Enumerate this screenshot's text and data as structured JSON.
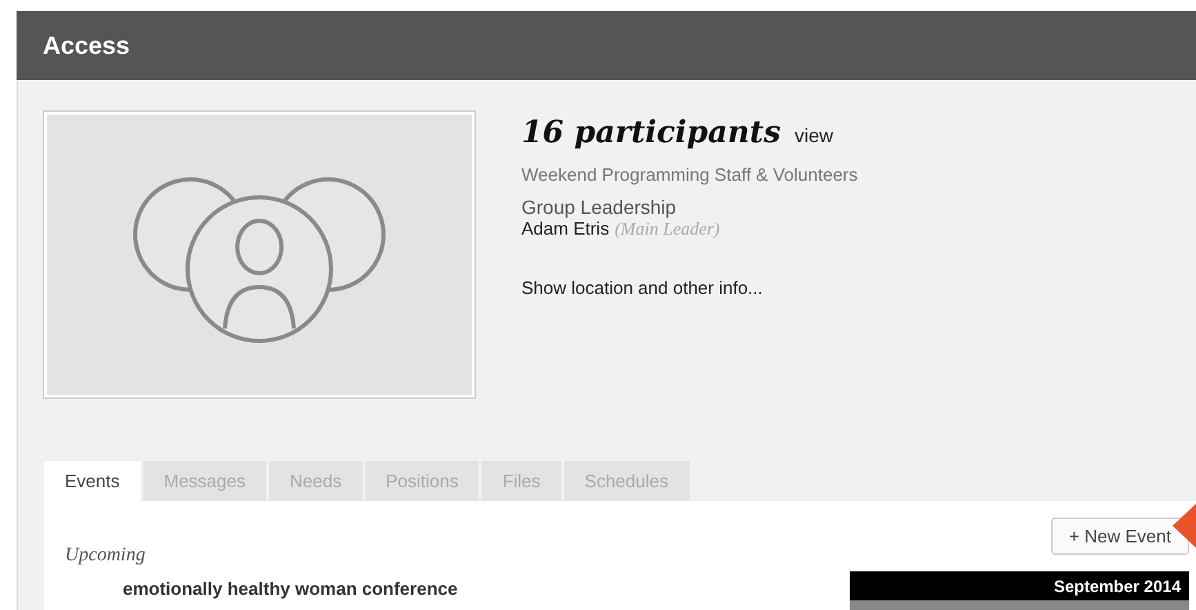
{
  "header": {
    "title": "Access"
  },
  "group": {
    "count_title": "16 participants",
    "view_link": "view",
    "name": "Weekend Programming Staff & Volunteers",
    "leadership_label": "Group Leadership",
    "leader": "Adam Etris",
    "leader_role": "(Main Leader)",
    "more_link": "Show location and other info..."
  },
  "tabs": [
    {
      "label": "Events",
      "selected": true
    },
    {
      "label": "Messages",
      "selected": false
    },
    {
      "label": "Needs",
      "selected": false
    },
    {
      "label": "Positions",
      "selected": false
    },
    {
      "label": "Files",
      "selected": false
    },
    {
      "label": "Schedules",
      "selected": false
    }
  ],
  "new_event_button": "+ New Event",
  "section_label": "Upcoming",
  "events": [
    "emotionally healthy woman conference"
  ],
  "calendar": {
    "month": "September 2014"
  }
}
